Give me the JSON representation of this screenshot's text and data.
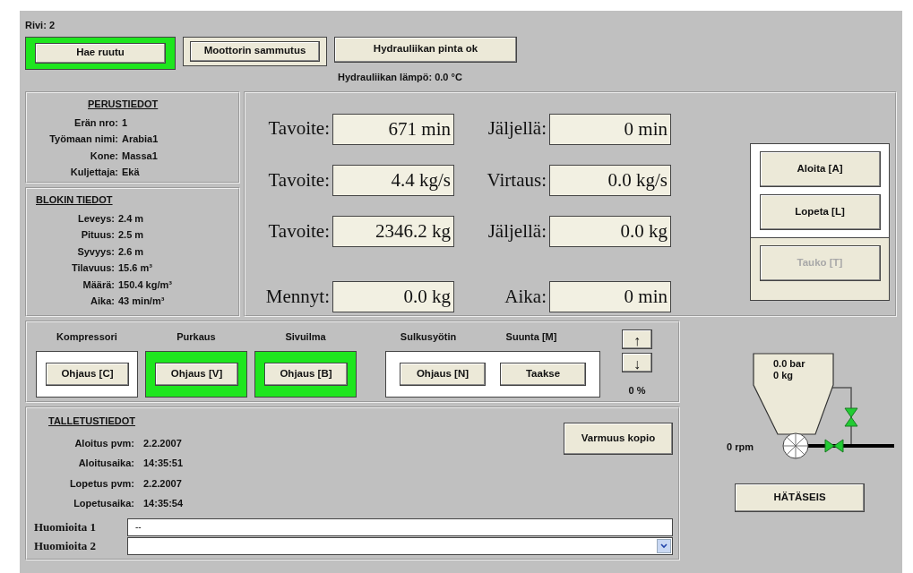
{
  "row_label": "Rivi: 2",
  "top_buttons": [
    {
      "label": "Hae ruutu",
      "kind": "framed",
      "active": true
    },
    {
      "label": "Moottorin sammutus",
      "kind": "framed",
      "active": false
    },
    {
      "label": "Hydrauliikan pinta ok",
      "kind": "plain"
    }
  ],
  "hydraulic_temp": "Hydrauliikan lämpö: 0.0 °C",
  "basic_info": {
    "title": "PERUSTIEDOT",
    "rows": [
      {
        "label": "Erän nro:",
        "value": "1"
      },
      {
        "label": "Työmaan nimi:",
        "value": "Arabia1"
      },
      {
        "label": "Kone:",
        "value": "Massa1"
      },
      {
        "label": "Kuljettaja:",
        "value": "Ekä"
      }
    ]
  },
  "block_info": {
    "title": "BLOKIN TIEDOT",
    "rows": [
      {
        "label": "Leveys:",
        "value": "2.4 m"
      },
      {
        "label": "Pituus:",
        "value": "2.5 m"
      },
      {
        "label": "Syvyys:",
        "value": "2.6 m"
      },
      {
        "label": "Tilavuus:",
        "value": "15.6 m³"
      },
      {
        "label": "Määrä:",
        "value": "150.4 kg/m³"
      },
      {
        "label": "Aika:",
        "value": "43 min/m³"
      }
    ]
  },
  "readouts": [
    {
      "label": "Tavoite:",
      "value": "671 min"
    },
    {
      "label": "Jäljellä:",
      "value": "0 min"
    },
    {
      "label": "Tavoite:",
      "value": "4.4 kg/s"
    },
    {
      "label": "Virtaus:",
      "value": "0.0 kg/s"
    },
    {
      "label": "Tavoite:",
      "value": "2346.2 kg"
    },
    {
      "label": "Jäljellä:",
      "value": "0.0 kg"
    },
    {
      "label": "Mennyt:",
      "value": "0.0 kg"
    },
    {
      "label": "Aika:",
      "value": "0 min"
    }
  ],
  "run_buttons": [
    {
      "label": "Aloita [A]",
      "disabled": false
    },
    {
      "label": "Lopeta [L]",
      "disabled": false
    },
    {
      "label": "Tauko [T]",
      "disabled": true
    }
  ],
  "controls": [
    {
      "title": "Kompressori",
      "button": "Ohjaus [C]",
      "active": false
    },
    {
      "title": "Purkaus",
      "button": "Ohjaus [V]",
      "active": true
    },
    {
      "title": "Sivuilma",
      "button": "Ohjaus [B]",
      "active": true
    }
  ],
  "feeder": [
    {
      "title": "Sulkusyötin",
      "button": "Ohjaus [N]"
    },
    {
      "title": "Suunta [M]",
      "button": "Taakse"
    }
  ],
  "arrows": {
    "up": "↑",
    "down": "↓",
    "percent": "0 %"
  },
  "storage": {
    "title": "TALLETUSTIEDOT",
    "rows": [
      {
        "label": "Aloitus pvm:",
        "value": "2.2.2007"
      },
      {
        "label": "Aloitusaika:",
        "value": "14:35:51"
      },
      {
        "label": "Lopetus pvm:",
        "value": "2.2.2007"
      },
      {
        "label": "Lopetusaika:",
        "value": "14:35:54"
      }
    ],
    "backup_button": "Varmuus kopio",
    "notes": [
      {
        "label": "Huomioita 1",
        "kind": "text",
        "value": "--"
      },
      {
        "label": "Huomioita 2",
        "kind": "select"
      }
    ]
  },
  "diagram": {
    "pressure": "0.0 bar",
    "mass": "0 kg",
    "speed": "0 rpm"
  },
  "emergency_button": "HÄTÄSEIS"
}
